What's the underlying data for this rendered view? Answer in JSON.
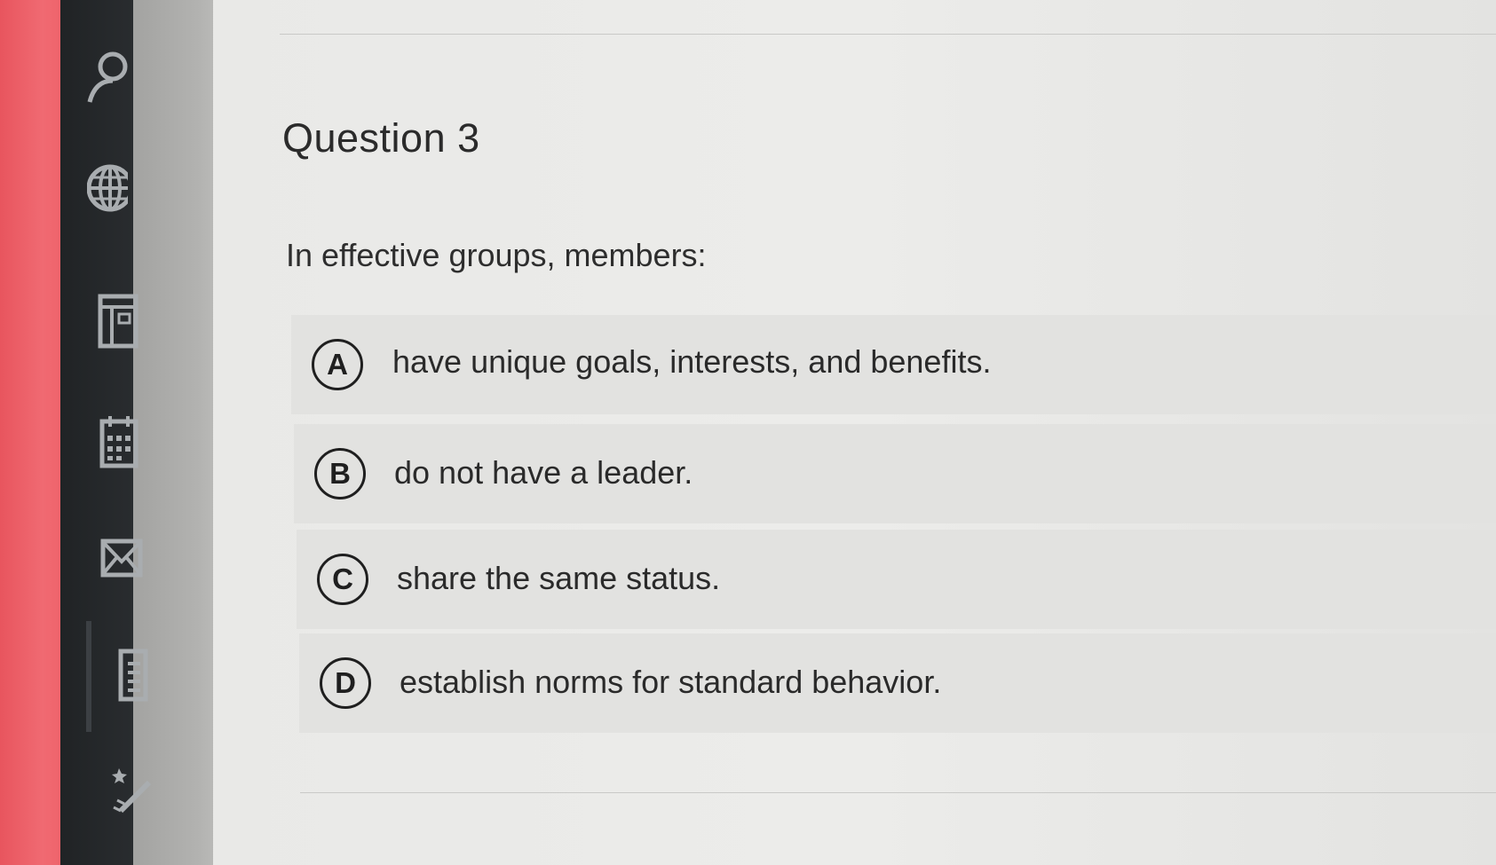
{
  "question": {
    "title": "Question 3",
    "prompt": "In effective groups, members:",
    "options": [
      {
        "letter": "A",
        "text": "have unique goals, interests, and benefits."
      },
      {
        "letter": "B",
        "text": "do not have a leader."
      },
      {
        "letter": "C",
        "text": "share the same status."
      },
      {
        "letter": "D",
        "text": "establish norms for standard behavior."
      }
    ]
  },
  "sidebar": {
    "icons": [
      "account-icon",
      "globe-icon",
      "courses-icon",
      "calendar-icon",
      "inbox-icon",
      "history-icon",
      "help-icon"
    ]
  },
  "colors": {
    "sidebar_bg": "#25282b",
    "page_bg": "#ebebe9",
    "option_bg": "#e2e2e0",
    "text": "#2b2b2b",
    "device_edge": "#ee6068"
  }
}
